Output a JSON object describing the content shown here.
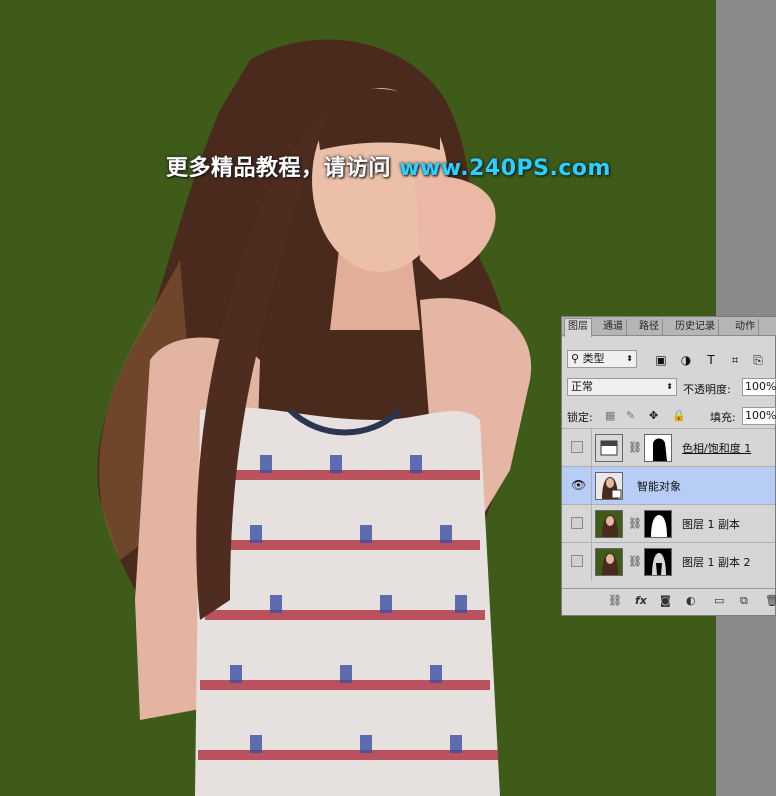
{
  "watermark": {
    "text": "更多精品教程，请访问",
    "url": "www.240PS.com"
  },
  "panel": {
    "tabs": [
      "图层",
      "通道",
      "路径",
      "历史记录",
      "动作"
    ],
    "filter": {
      "label": "类型",
      "icon": "search-icon"
    },
    "blend_mode": "正常",
    "opacity_label": "不透明度:",
    "opacity_value": "100%",
    "lock_label": "锁定:",
    "fill_label": "填充:",
    "fill_value": "100%",
    "layers": [
      {
        "name": "色相/饱和度 1",
        "visible": false,
        "type": "adjustment"
      },
      {
        "name": "智能对象",
        "visible": true,
        "type": "smart-object",
        "selected": true
      },
      {
        "name": "图层 1 副本",
        "visible": false,
        "type": "masked"
      },
      {
        "name": "图层 1 副本 2",
        "visible": false,
        "type": "masked"
      }
    ],
    "bottom_icons": [
      "link-icon",
      "fx-icon",
      "mask-icon",
      "adjustment-icon",
      "group-icon",
      "new-layer-icon",
      "trash-icon"
    ],
    "fx_label": "fx"
  },
  "colors": {
    "background": "#3e5b19",
    "selection": "#b8cdf5",
    "url": "#2ad0ff"
  }
}
